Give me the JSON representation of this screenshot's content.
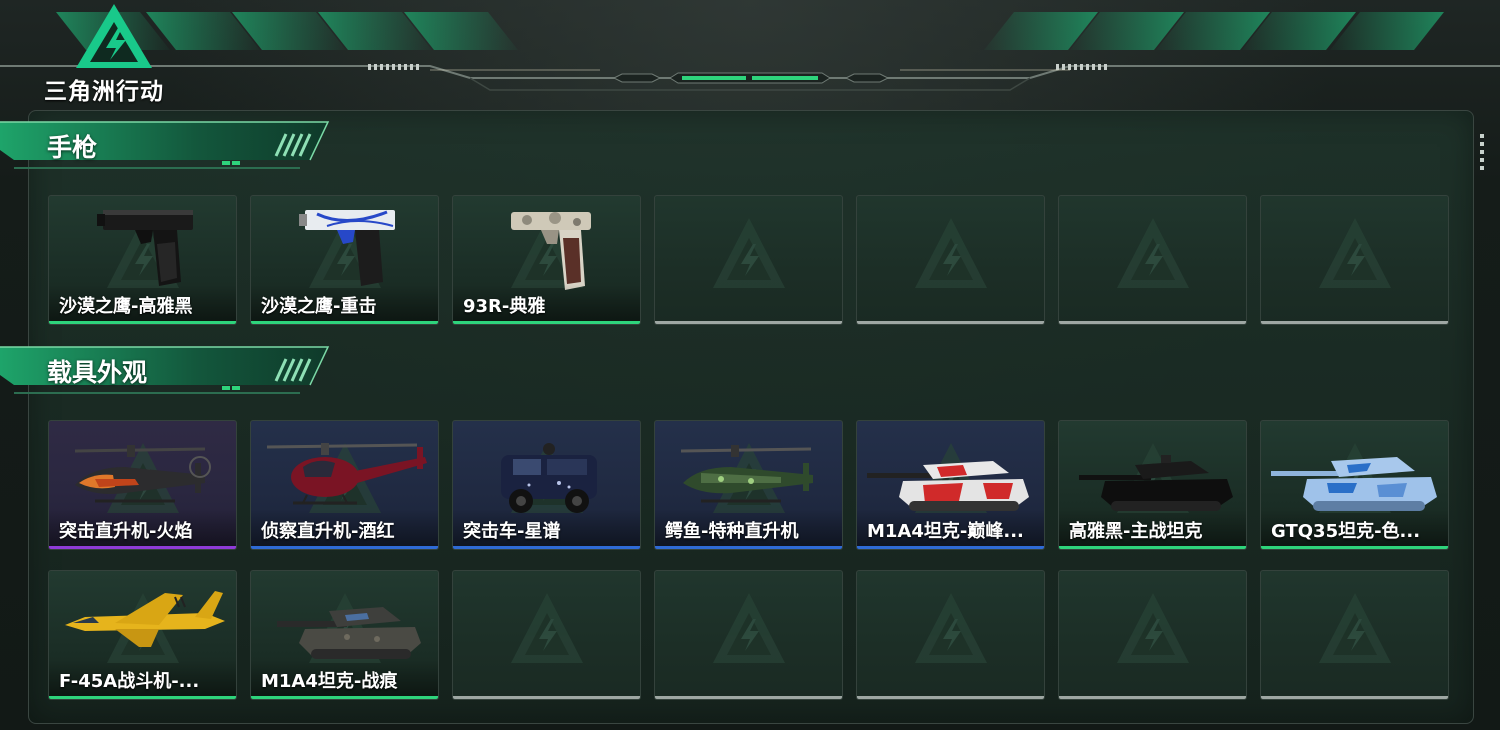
{
  "app": {
    "logo_text": "三角洲行动"
  },
  "colors": {
    "accent": "#2ed47c",
    "rarity_green": "#2ed47c",
    "rarity_purple": "#8f3bd8",
    "rarity_blue": "#2f6bd6",
    "empty_slot": "#9ea7a3"
  },
  "sections": [
    {
      "title": "手枪",
      "items": [
        {
          "label": "沙漠之鹰-高雅黑",
          "rarity": "green",
          "icon": "pistol-black-icon"
        },
        {
          "label": "沙漠之鹰-重击",
          "rarity": "green",
          "icon": "pistol-white-icon"
        },
        {
          "label": "93R-典雅",
          "rarity": "green",
          "icon": "pistol-camo-icon"
        },
        {
          "label": "",
          "rarity": "empty"
        },
        {
          "label": "",
          "rarity": "empty"
        },
        {
          "label": "",
          "rarity": "empty"
        },
        {
          "label": "",
          "rarity": "empty"
        }
      ]
    },
    {
      "title": "载具外观",
      "items": [
        {
          "label": "突击直升机-火焰",
          "rarity": "purple",
          "icon": "attack-helicopter-icon"
        },
        {
          "label": "侦察直升机-酒红",
          "rarity": "blue",
          "icon": "scout-helicopter-icon"
        },
        {
          "label": "突击车-星谱",
          "rarity": "blue",
          "icon": "assault-vehicle-icon"
        },
        {
          "label": "鳄鱼-特种直升机",
          "rarity": "blue",
          "icon": "special-helicopter-icon"
        },
        {
          "label": "M1A4坦克-巅峰...",
          "rarity": "blue",
          "icon": "tank-red-white-icon"
        },
        {
          "label": "高雅黑-主战坦克",
          "rarity": "green",
          "icon": "tank-black-icon"
        },
        {
          "label": "GTQ35坦克-色...",
          "rarity": "green",
          "icon": "tank-blue-camo-icon"
        },
        {
          "label": "F-45A战斗机-...",
          "rarity": "green",
          "icon": "fighter-jet-icon"
        },
        {
          "label": "M1A4坦克-战痕",
          "rarity": "green",
          "icon": "tank-battle-worn-icon"
        },
        {
          "label": "",
          "rarity": "empty"
        },
        {
          "label": "",
          "rarity": "empty"
        },
        {
          "label": "",
          "rarity": "empty"
        },
        {
          "label": "",
          "rarity": "empty"
        },
        {
          "label": "",
          "rarity": "empty"
        }
      ]
    }
  ]
}
